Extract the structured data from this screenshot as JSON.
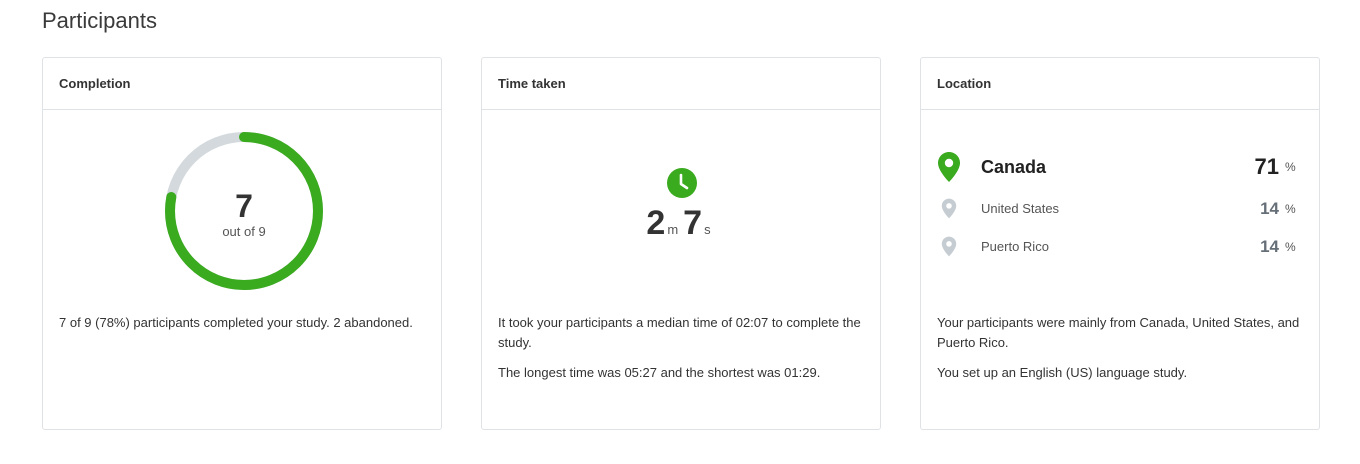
{
  "page": {
    "title": "Participants"
  },
  "completion": {
    "header": "Completion",
    "completed": "7",
    "out_of": "out of 9",
    "fraction": 0.78,
    "ring_color": "#3aaa1f",
    "track_color": "#d3d9dc",
    "description": "7 of 9 (78%) participants completed your study. 2 abandoned."
  },
  "time_taken": {
    "header": "Time taken",
    "icon": "clock-icon",
    "minutes": "2",
    "minutes_unit": "m",
    "seconds": "7",
    "seconds_unit": "s",
    "description_1": "It took your participants a median time of 02:07 to complete the study.",
    "description_2": "The longest time was 05:27 and the shortest was 01:29."
  },
  "location": {
    "header": "Location",
    "icon": "map-pin-icon",
    "accent": "#3aaa1f",
    "muted": "#c6cdd2",
    "items": [
      {
        "name": "Canada",
        "value": "71",
        "unit": "%"
      },
      {
        "name": "United States",
        "value": "14",
        "unit": "%"
      },
      {
        "name": "Puerto Rico",
        "value": "14",
        "unit": "%"
      }
    ],
    "description_1": "Your participants were mainly from Canada, United States, and Puerto Rico.",
    "description_2": "You set up an English (US) language study."
  }
}
